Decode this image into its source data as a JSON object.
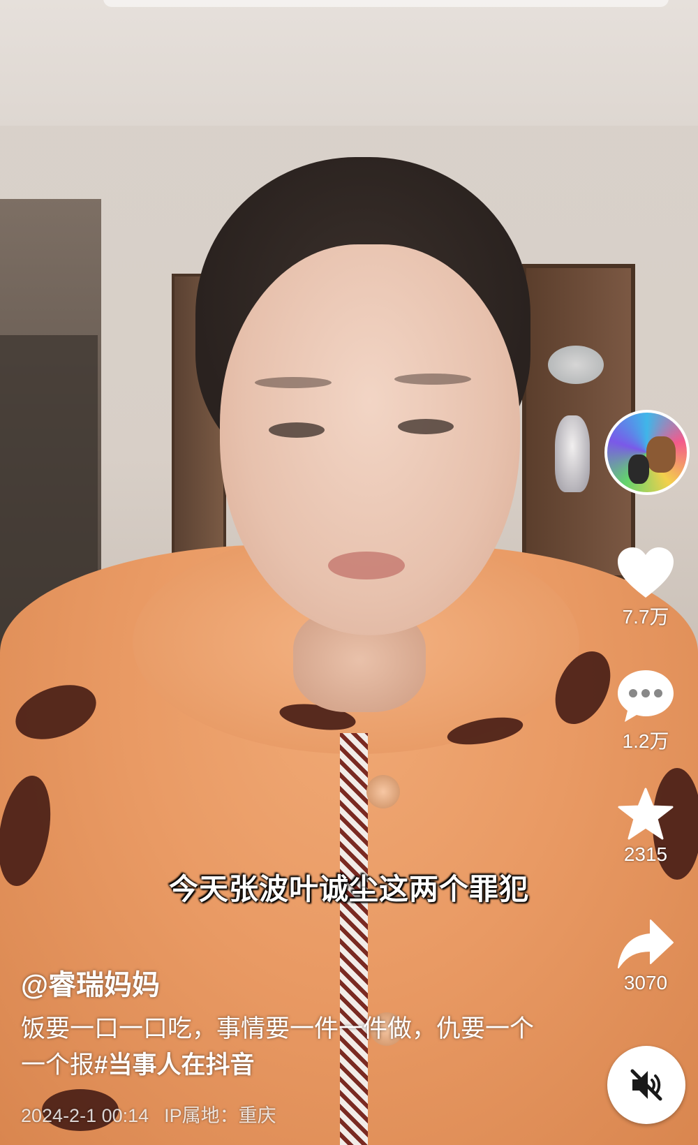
{
  "video": {
    "subtitle": "今天张波叶诚尘这两个罪犯"
  },
  "rail": {
    "like_count": "7.7万",
    "comment_count": "1.2万",
    "favorite_count": "2315",
    "share_count": "3070"
  },
  "post": {
    "author": "@睿瑞妈妈",
    "description": "饭要一口一口吃，事情要一件一件做，仇要一个一个报",
    "hashtag": "#当事人在抖音",
    "date": "2024-2-1 00:14",
    "ip_label": "IP属地：重庆"
  },
  "icons": {
    "like": "heart-icon",
    "comment": "comment-bubble-icon",
    "favorite": "star-icon",
    "share": "share-arrow-icon",
    "mute": "speaker-muted-icon"
  },
  "colors": {
    "overlay_text": "#ffffff",
    "robe": "#e99a64"
  }
}
